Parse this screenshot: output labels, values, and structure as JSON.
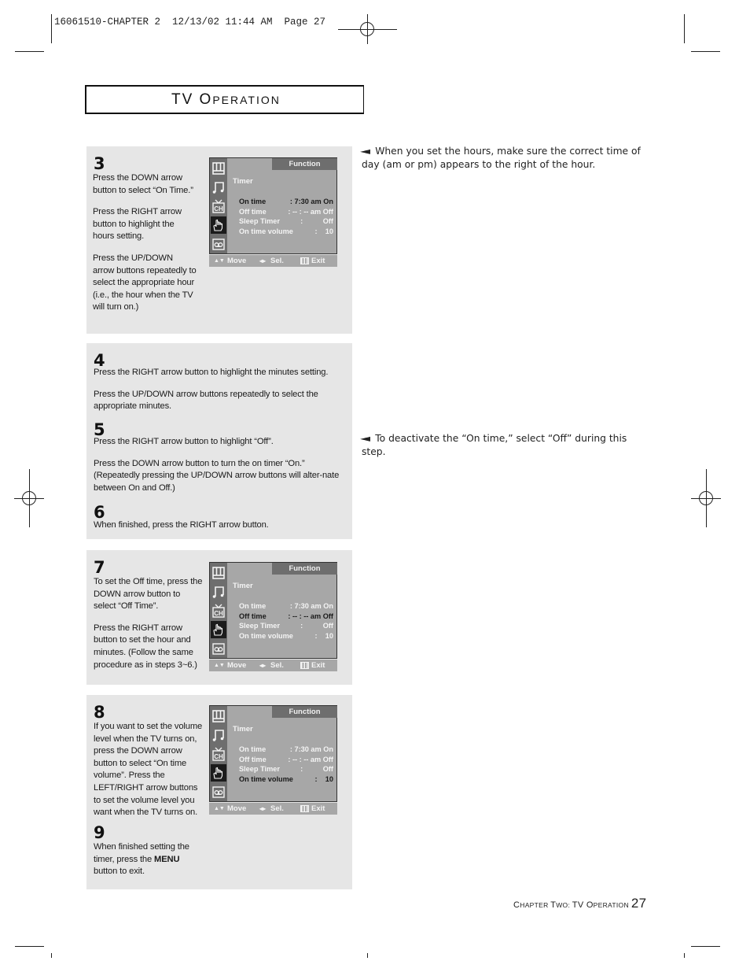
{
  "slug": {
    "text": "16061510-CHAPTER 2  12/13/02 11:44 AM  Page 27"
  },
  "header": {
    "title_first": "TV O",
    "title_rest": "PERATION",
    "title_full": "TV Operation"
  },
  "osd_common": {
    "function_label": "Function",
    "section_label": "Timer",
    "icons": [
      "picture-icon",
      "sound-icon",
      "channel-icon",
      "function-hand-icon",
      "input-icon"
    ],
    "selected_icon": "function-hand-icon",
    "bottom_bar": {
      "move_arrows": "▲▼",
      "move_label": "Move",
      "sel_arrows": "◂▸",
      "sel_label": "Sel.",
      "exit_label": "Exit"
    },
    "colors": {
      "screen_bg": "#a7a7a7",
      "sidebar_bg": "#6e6e6e",
      "selected_icon_bg": "#1b1b1b",
      "text_normal": "#f4f4f4",
      "text_highlight": "#1a1a1a"
    }
  },
  "osd_screens": [
    {
      "rows": [
        {
          "label": "On time",
          "value": ": 7:30 am On",
          "highlighted": true
        },
        {
          "label": "Off time",
          "value": ": -- : -- am Off",
          "highlighted": false
        },
        {
          "label": "Sleep Timer",
          "value": ":          Off",
          "highlighted": false
        },
        {
          "label": "On time volume",
          "value": ":    10",
          "highlighted": false
        }
      ]
    },
    {
      "rows": [
        {
          "label": "On time",
          "value": ": 7:30 am On",
          "highlighted": false
        },
        {
          "label": "Off time",
          "value": ": -- : -- am Off",
          "highlighted": true
        },
        {
          "label": "Sleep Timer",
          "value": ":          Off",
          "highlighted": false
        },
        {
          "label": "On time volume",
          "value": ":    10",
          "highlighted": false
        }
      ]
    },
    {
      "rows": [
        {
          "label": "On time",
          "value": ": 7:30 am On",
          "highlighted": false
        },
        {
          "label": "Off time",
          "value": ": -- : -- am Off",
          "highlighted": false
        },
        {
          "label": "Sleep Timer",
          "value": ":          Off",
          "highlighted": false
        },
        {
          "label": "On time volume",
          "value": ":    10",
          "highlighted": true
        }
      ]
    }
  ],
  "steps": {
    "s3": {
      "number": "3",
      "paragraphs": [
        "Press the DOWN arrow button to select “On Time.”",
        "Press the RIGHT arrow button to highlight the hours setting.",
        "Press the UP/DOWN arrow buttons repeatedly to select the appropriate hour (i.e., the hour when the TV will turn on.)"
      ]
    },
    "s4": {
      "number": "4",
      "paragraphs": [
        "Press the RIGHT arrow button to highlight the minutes setting.",
        "Press the UP/DOWN arrow buttons repeatedly to select the appropriate minutes."
      ]
    },
    "s5": {
      "number": "5",
      "paragraphs": [
        "Press the RIGHT arrow button to highlight “Off”.",
        "Press the DOWN arrow button to turn the on timer “On.” (Repeatedly pressing the UP/DOWN arrow buttons will alter-nate between On and Off.)"
      ]
    },
    "s6": {
      "number": "6",
      "paragraphs": [
        "When finished, press the RIGHT arrow button."
      ]
    },
    "s7": {
      "number": "7",
      "paragraphs": [
        "To set the Off time, press the DOWN arrow button to select “Off Time”.",
        "Press the RIGHT arrow button to set the hour and minutes. (Follow the same procedure as in steps 3~6.)"
      ]
    },
    "s8": {
      "number": "8",
      "paragraphs": [
        "If you want to set the volume level when the TV turns on, press the DOWN arrow button to select “On time volume”. Press the LEFT/RIGHT arrow buttons to set the volume level you want when the TV turns on."
      ]
    },
    "s9": {
      "number": "9",
      "text_before": "When finished setting the timer, press the ",
      "text_bold": "MENU",
      "text_after": " button to exit."
    }
  },
  "notes": [
    {
      "icon": "pointer-left-icon",
      "glyph": "◄",
      "text": "When you set the hours, make sure the correct time of day (am or pm) appears to the right of the hour."
    },
    {
      "icon": "pointer-left-icon",
      "glyph": "◄",
      "text": "To deactivate the “On time,” select “Off” during this step."
    }
  ],
  "footer": {
    "chapter_c": "C",
    "chapter_rest1": "HAPTER ",
    "chapter_t": "T",
    "chapter_rest2": "WO: ",
    "section_tv": "TV ",
    "section_o": "O",
    "section_rest": "PERATION",
    "page_number": "27"
  }
}
